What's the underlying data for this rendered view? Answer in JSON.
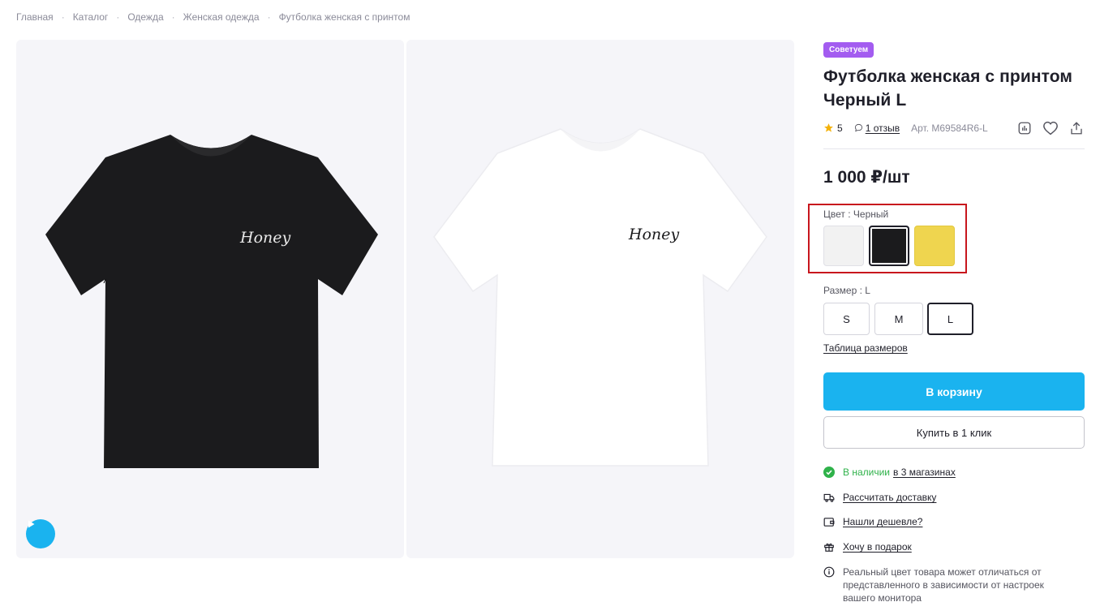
{
  "breadcrumb": [
    "Главная",
    "Каталог",
    "Одежда",
    "Женская одежда",
    "Футболка женская с принтом"
  ],
  "gallery": {
    "image1_print": "Honey",
    "image2_print": "Honey"
  },
  "product": {
    "badge": "Советуем",
    "title": "Футболка женская с принтом Черный L",
    "rating": "5",
    "reviews": "1 отзыв",
    "sku": "Арт. M69584R6-L",
    "price": "1 000 ₽/шт"
  },
  "color": {
    "label": "Цвет : Черный",
    "options": [
      {
        "name": "white",
        "hex": "#f2f2f2"
      },
      {
        "name": "black",
        "hex": "#1b1b1d",
        "selected": true
      },
      {
        "name": "yellow",
        "hex": "#efd54f"
      }
    ]
  },
  "size": {
    "label": "Размер : L",
    "options": [
      "S",
      "M",
      "L"
    ],
    "selected": "L",
    "table_link": "Таблица размеров"
  },
  "actions": {
    "cart": "В корзину",
    "one_click": "Купить в 1 клик"
  },
  "availability": {
    "status": "В наличии",
    "stores": "в 3 магазинах"
  },
  "links": {
    "delivery": "Рассчитать доставку",
    "cheaper": "Нашли дешевле?",
    "gift": "Хочу в подарок"
  },
  "disclaimer": "Реальный цвет товара может отличаться от представленного в зависимости от настроек вашего монитора",
  "colors": {
    "accent": "#1ab3ef",
    "badge": "#a35cf0",
    "highlight": "#c8161d",
    "in_stock": "#2fb24a"
  }
}
